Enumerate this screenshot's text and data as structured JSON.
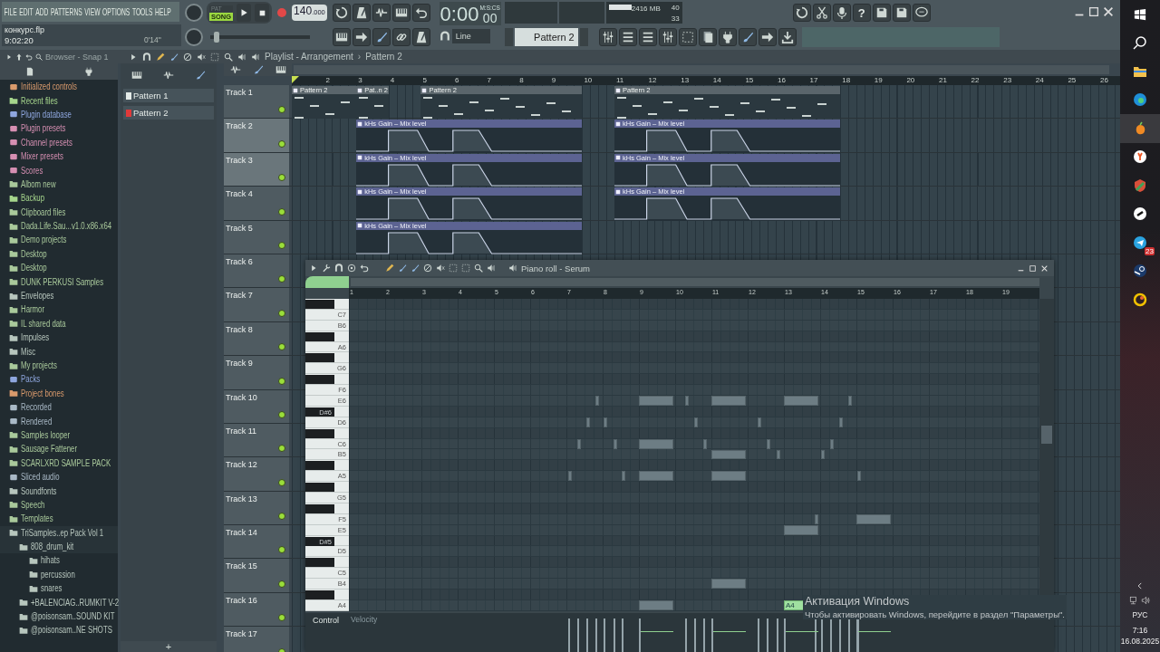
{
  "menu": [
    "FILE",
    "EDIT",
    "ADD",
    "PATTERNS",
    "VIEW",
    "OPTIONS",
    "TOOLS",
    "HELP"
  ],
  "project": {
    "filename": "конкурс.flp",
    "elapsed": "9:02:20",
    "duration": "0'14''"
  },
  "transport": {
    "modes": [
      {
        "label": "PAT",
        "selected": false
      },
      {
        "label": "SONG",
        "selected": true
      }
    ],
    "tempo": "140",
    "tempo_fraction": ".000",
    "time": "0:00",
    "time_fraction": "00",
    "time_unit": "M:S:CS"
  },
  "pitch_slider": {
    "level": 0.04
  },
  "meters": {
    "cpu": "40",
    "memory": "2416 MB",
    "polyphony": "33"
  },
  "help_button": "?",
  "snap": "Line",
  "pattern_selector": "Pattern 2",
  "browser": {
    "title": "Browser - Snap 1",
    "items": [
      {
        "label": "Initialized controls",
        "kind": "special",
        "color": "#d99a6c"
      },
      {
        "label": "Recent files",
        "kind": "folder",
        "color": "#a6d68c"
      },
      {
        "label": "Plugin database",
        "kind": "special",
        "color": "#8ea6de"
      },
      {
        "label": "Plugin presets",
        "kind": "special",
        "color": "#d68fb2"
      },
      {
        "label": "Channel presets",
        "kind": "special",
        "color": "#d68fb2"
      },
      {
        "label": "Mixer presets",
        "kind": "special",
        "color": "#d68fb2"
      },
      {
        "label": "Scores",
        "kind": "special",
        "color": "#d68fb2"
      },
      {
        "label": "Albom new",
        "kind": "folder",
        "color": "#a9c99b"
      },
      {
        "label": "Backup",
        "kind": "folder",
        "color": "#a6d68c"
      },
      {
        "label": "Clipboard files",
        "kind": "folder",
        "color": "#a9c99b"
      },
      {
        "label": "Dada.Life.Sau...v1.0.x86.x64",
        "kind": "folder",
        "color": "#a9c99b"
      },
      {
        "label": "Demo projects",
        "kind": "folder",
        "color": "#a9c99b"
      },
      {
        "label": "Desktop",
        "kind": "folder",
        "color": "#a9c99b"
      },
      {
        "label": "Desktop",
        "kind": "folder",
        "color": "#a9c99b"
      },
      {
        "label": "DUNK PERKUSI Samples",
        "kind": "folder",
        "color": "#a9c99b"
      },
      {
        "label": "Envelopes",
        "kind": "folder",
        "color": "#b7c6bd"
      },
      {
        "label": "Harmor",
        "kind": "folder",
        "color": "#a9c99b"
      },
      {
        "label": "IL shared data",
        "kind": "folder",
        "color": "#a9c99b"
      },
      {
        "label": "Impulses",
        "kind": "folder",
        "color": "#b7c6bd"
      },
      {
        "label": "Misc",
        "kind": "folder",
        "color": "#b7c6bd"
      },
      {
        "label": "My projects",
        "kind": "folder",
        "color": "#a9c99b"
      },
      {
        "label": "Packs",
        "kind": "special",
        "color": "#8ea6de"
      },
      {
        "label": "Project bones",
        "kind": "folder",
        "color": "#d99a6c"
      },
      {
        "label": "Recorded",
        "kind": "special",
        "color": "#a9b9c6"
      },
      {
        "label": "Rendered",
        "kind": "special",
        "color": "#a9b9c6"
      },
      {
        "label": "Samples looper",
        "kind": "folder",
        "color": "#a9c99b"
      },
      {
        "label": "Sausage Fattener",
        "kind": "folder",
        "color": "#a9c99b"
      },
      {
        "label": "SCARLXRD SAMPLE PACK",
        "kind": "folder",
        "color": "#a9c99b"
      },
      {
        "label": "Sliced audio",
        "kind": "special",
        "color": "#a9b9c6"
      },
      {
        "label": "Soundfonts",
        "kind": "folder",
        "color": "#b7c6bd"
      },
      {
        "label": "Speech",
        "kind": "folder",
        "color": "#a9c99b"
      },
      {
        "label": "Templates",
        "kind": "folder",
        "color": "#a9c99b"
      },
      {
        "label": "TriSamples..ep Pack Vol 1",
        "kind": "folder",
        "color": "#b7c6bd",
        "children": [
          {
            "label": "808_drum_kit",
            "kind": "folder",
            "color": "#b7c6bd",
            "children": [
              {
                "label": "hihats",
                "kind": "folder",
                "color": "#b7c6bd"
              },
              {
                "label": "percussion",
                "kind": "folder",
                "color": "#b7c6bd"
              },
              {
                "label": "snares",
                "kind": "folder",
                "color": "#b7c6bd"
              }
            ]
          },
          {
            "label": "+BALENCIAG..RUMKIT V-2",
            "kind": "folder",
            "color": "#b7c6bd"
          },
          {
            "label": "@poisonsam..SOUND  KIT",
            "kind": "folder",
            "color": "#b7c6bd"
          },
          {
            "label": "@poisonsam..NE SHOTS",
            "kind": "folder",
            "color": "#b7c6bd"
          }
        ]
      }
    ]
  },
  "patterns": [
    {
      "label": "Pattern 1",
      "selected": false
    },
    {
      "label": "Pattern 2",
      "selected": true
    }
  ],
  "add_button": "+",
  "playlist": {
    "title": "Playlist - Arrangement",
    "separator": "›",
    "breadcrumb": "Pattern 2",
    "ruler": [
      "2",
      "3",
      "4",
      "5",
      "6",
      "7",
      "8",
      "9",
      "10",
      "11",
      "12",
      "13",
      "14",
      "15",
      "16",
      "17",
      "18",
      "19",
      "20",
      "21",
      "22",
      "23",
      "24",
      "25",
      "26"
    ],
    "tracks": [
      {
        "name": "Track 1",
        "selected": false,
        "clips": [
          {
            "kind": "pattern",
            "label": "Pattern 2"
          },
          {
            "kind": "pattern",
            "label": "Pat..n 2"
          },
          {
            "kind": "pattern",
            "label": "Pattern 2"
          },
          {
            "kind": "pattern",
            "label": "Pattern 2"
          }
        ]
      },
      {
        "name": "Track 2",
        "selected": true,
        "clips": [
          {
            "kind": "automation",
            "label": "kHs Gain – Mix level"
          },
          {
            "kind": "automation",
            "label": "kHs Gain – Mix level"
          }
        ]
      },
      {
        "name": "Track 3",
        "selected": true,
        "clips": [
          {
            "kind": "automation",
            "label": "kHs Gain – Mix level"
          },
          {
            "kind": "automation",
            "label": "kHs Gain – Mix level"
          }
        ]
      },
      {
        "name": "Track 4",
        "selected": false,
        "clips": [
          {
            "kind": "automation",
            "label": "kHs Gain – Mix level"
          },
          {
            "kind": "automation",
            "label": "kHs Gain – Mix level"
          }
        ]
      },
      {
        "name": "Track 5",
        "selected": false,
        "clips": [
          {
            "kind": "automation",
            "label": "kHs Gain – Mix level"
          }
        ]
      },
      {
        "name": "Track 6",
        "selected": false
      },
      {
        "name": "Track 7",
        "selected": false
      },
      {
        "name": "Track 8",
        "selected": false
      },
      {
        "name": "Track 9",
        "selected": false
      },
      {
        "name": "Track 10",
        "selected": false
      },
      {
        "name": "Track 11",
        "selected": false
      },
      {
        "name": "Track 12",
        "selected": false
      },
      {
        "name": "Track 13",
        "selected": false
      },
      {
        "name": "Track 14",
        "selected": false
      },
      {
        "name": "Track 15",
        "selected": false
      },
      {
        "name": "Track 16",
        "selected": false
      },
      {
        "name": "Track 17",
        "selected": false
      }
    ]
  },
  "piano_roll": {
    "title": "Piano roll - Serum",
    "ruler": [
      "1",
      "2",
      "3",
      "4",
      "5",
      "6",
      "7",
      "8",
      "9",
      "10",
      "11",
      "12",
      "13",
      "14",
      "15",
      "16",
      "17",
      "18",
      "19"
    ],
    "keys": [
      {
        "kind": "black"
      },
      {
        "kind": "white",
        "label": "C7"
      },
      {
        "kind": "white",
        "label": "B6"
      },
      {
        "kind": "black"
      },
      {
        "kind": "white",
        "label": "A6"
      },
      {
        "kind": "black"
      },
      {
        "kind": "white",
        "label": "G6"
      },
      {
        "kind": "black"
      },
      {
        "kind": "white",
        "label": "F6"
      },
      {
        "kind": "white",
        "label": "E6"
      },
      {
        "kind": "black",
        "label": "D#6"
      },
      {
        "kind": "white",
        "label": "D6"
      },
      {
        "kind": "black"
      },
      {
        "kind": "white",
        "label": "C6"
      },
      {
        "kind": "white",
        "label": "B5"
      },
      {
        "kind": "black"
      },
      {
        "kind": "white",
        "label": "A5"
      },
      {
        "kind": "black"
      },
      {
        "kind": "white",
        "label": "G5"
      },
      {
        "kind": "black"
      },
      {
        "kind": "white",
        "label": "F5"
      },
      {
        "kind": "white",
        "label": "E5"
      },
      {
        "kind": "black",
        "label": "D#5"
      },
      {
        "kind": "white",
        "label": "D5"
      },
      {
        "kind": "black"
      },
      {
        "kind": "white",
        "label": "C5"
      },
      {
        "kind": "white",
        "label": "B4"
      },
      {
        "kind": "black"
      },
      {
        "kind": "white",
        "label": "A4"
      }
    ],
    "selected_note": {
      "label": "A4"
    },
    "control_label": "Control",
    "lane": "Velocity"
  },
  "activation": {
    "title": "Активация Windows",
    "message": "Чтобы активировать Windows, перейдите в раздел \"Параметры\"."
  },
  "taskbar": {
    "badge": "23",
    "language": "РУС",
    "time": "7:16",
    "date": "16.08.2025"
  }
}
